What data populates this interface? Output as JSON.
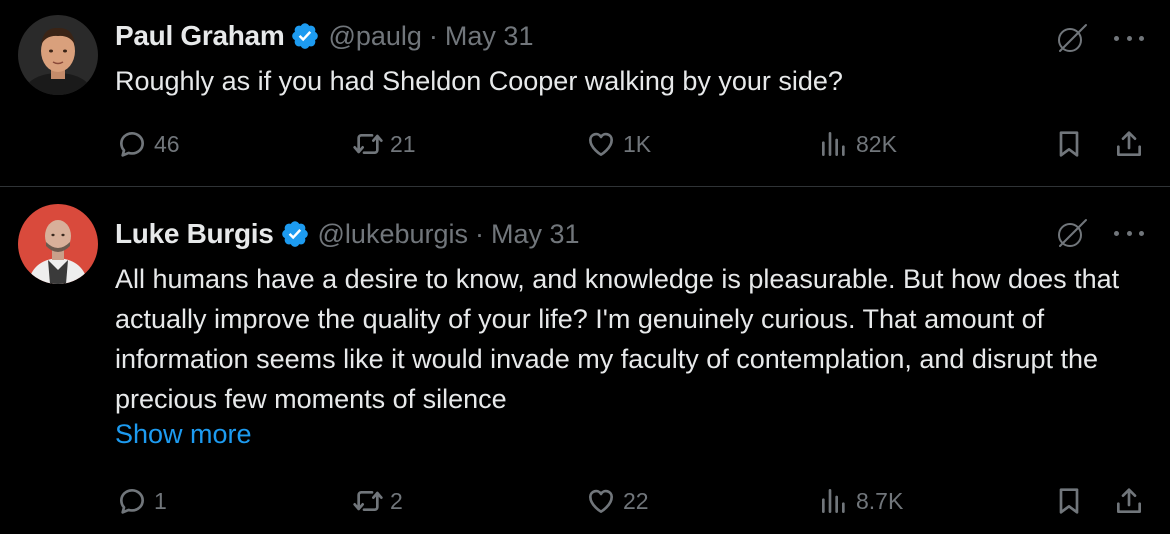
{
  "tweets": [
    {
      "author": "Paul Graham",
      "handle": "@paulg",
      "separator": "·",
      "date": "May 31",
      "text": "Roughly as if you had Sheldon Cooper walking by your side?",
      "replies": "46",
      "reposts": "21",
      "likes": "1K",
      "views": "82K"
    },
    {
      "author": "Luke Burgis",
      "handle": "@lukeburgis",
      "separator": "·",
      "date": "May 31",
      "text": "All humans have a desire to know, and knowledge is pleasurable. But how does that actually improve the quality of your life? I'm genuinely curious. That amount of information seems like it would invade my faculty of contemplation, and disrupt the precious few moments of silence",
      "show_more": "Show more",
      "replies": "1",
      "reposts": "2",
      "likes": "22",
      "views": "8.7K"
    }
  ],
  "colors": {
    "background": "#000000",
    "text": "#e7e9ea",
    "muted": "#71767b",
    "link": "#1d9bf0",
    "verified": "#1d9bf0",
    "divider": "#2f3336"
  },
  "icons": [
    "verified-badge-icon",
    "grok-icon",
    "more-icon",
    "reply-icon",
    "repost-icon",
    "like-icon",
    "views-icon",
    "bookmark-icon",
    "share-icon"
  ]
}
